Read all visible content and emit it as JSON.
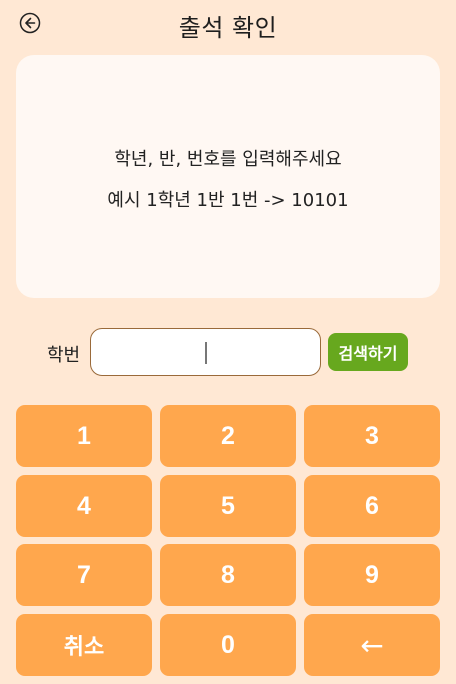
{
  "header": {
    "title": "출석 확인",
    "back_icon": "arrow-left-circle-icon"
  },
  "info": {
    "line1": "학년, 반, 번호를 입력해주세요",
    "line2": "예시 1학년 1반 1번 -> 10101"
  },
  "search": {
    "label": "학번",
    "value": "",
    "button_label": "검색하기"
  },
  "keypad": {
    "keys": [
      "1",
      "2",
      "3",
      "4",
      "5",
      "6",
      "7",
      "8",
      "9",
      "취소",
      "0",
      "←"
    ]
  },
  "colors": {
    "background": "#ffe8d4",
    "card": "#fff8f3",
    "key": "#ffa74d",
    "search_button": "#67a81e",
    "input_border": "#9a6a3a"
  }
}
